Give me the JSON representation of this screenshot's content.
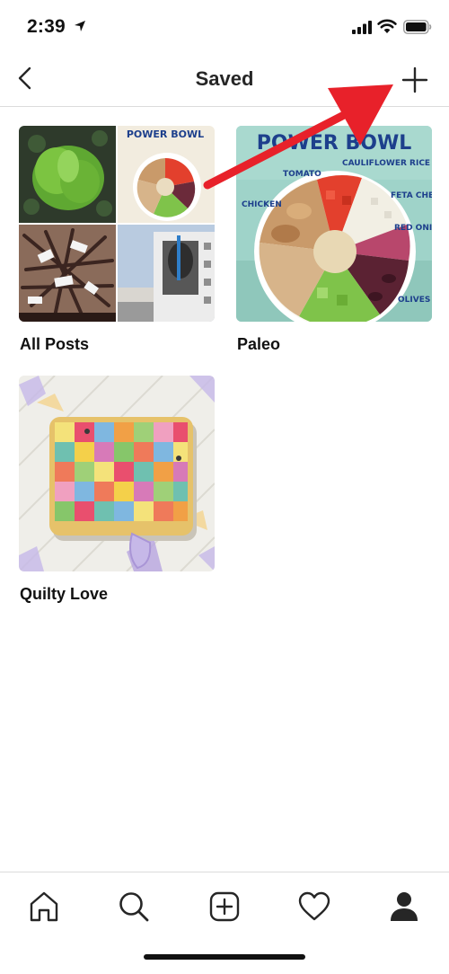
{
  "status_bar": {
    "time": "2:39"
  },
  "nav": {
    "title": "Saved"
  },
  "collections": [
    {
      "label": "All Posts"
    },
    {
      "label": "Paleo"
    },
    {
      "label": "Quilty Love"
    }
  ],
  "thumbnails": {
    "power_bowl_title": "POWER BOWL",
    "power_bowl_tags": [
      "CHICKEN",
      "TOMATO",
      "CAULIFLOWER RICE",
      "FETA CHEESE",
      "RED ONION",
      "OLIVES"
    ]
  },
  "tab_bar": {
    "tabs": [
      "home-icon",
      "search-icon",
      "new-post-icon",
      "activity-heart-icon",
      "profile-icon"
    ]
  },
  "colors": {
    "annotation_arrow": "#e8212a",
    "separator": "#dbdbdb",
    "power_bowl_title": "#1d3f8c"
  }
}
